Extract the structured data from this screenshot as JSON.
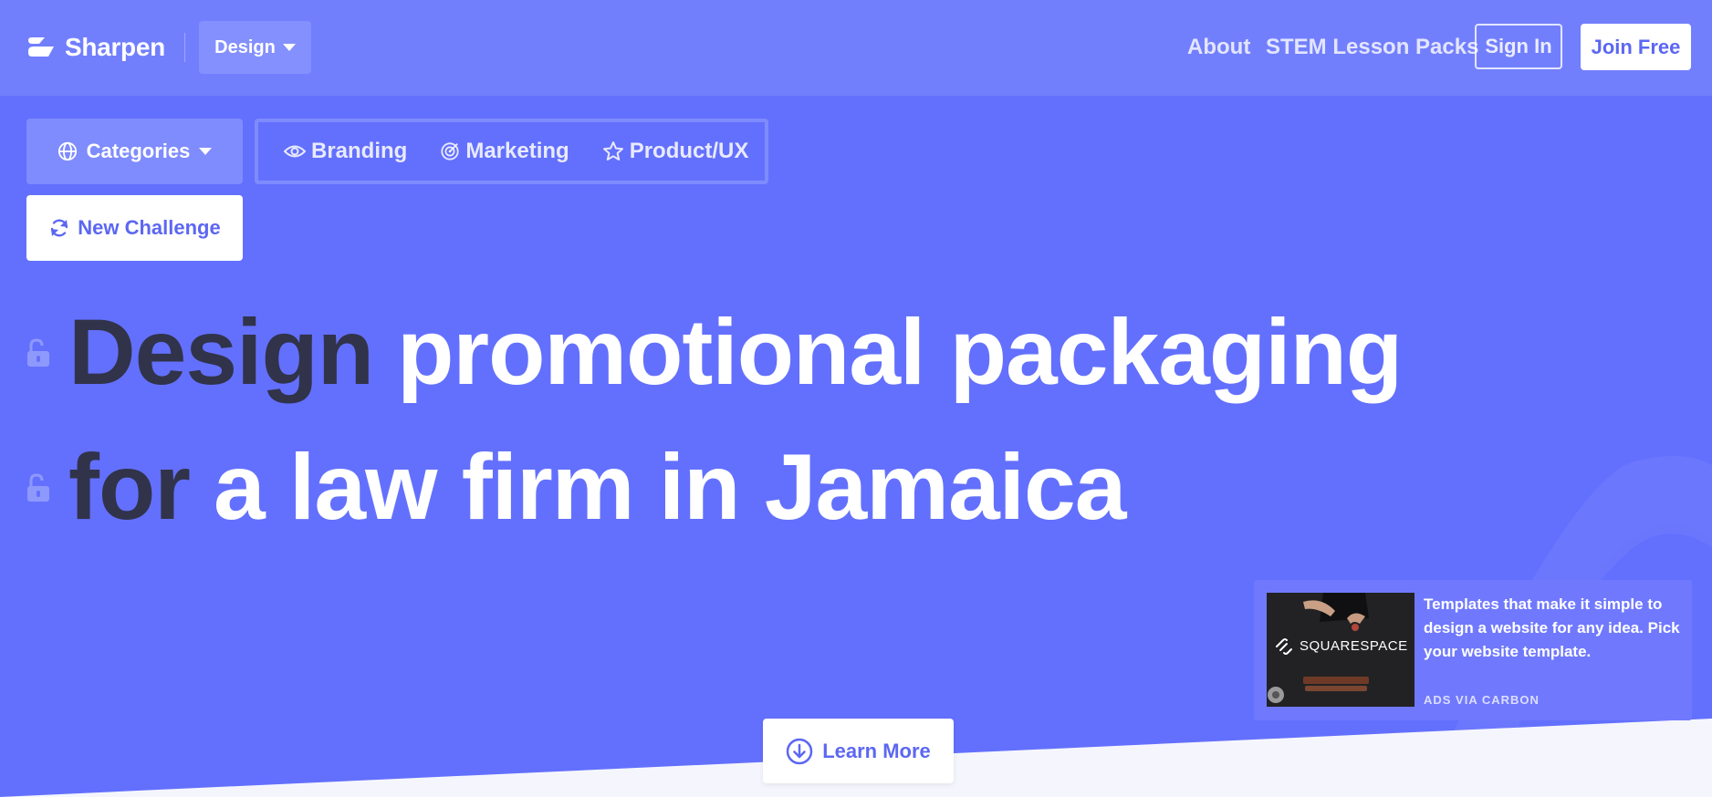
{
  "brand": {
    "name": "Sharpen",
    "accent": "#6370fd",
    "dark_text": "#31334a"
  },
  "header": {
    "category_dropdown": "Design",
    "nav": {
      "about": "About",
      "stem": "STEM Lesson Packs"
    },
    "sign_in": "Sign In",
    "join_free": "Join Free"
  },
  "filters": {
    "categories_label": "Categories",
    "items": [
      {
        "label": "Branding",
        "icon": "eye-icon"
      },
      {
        "label": "Marketing",
        "icon": "target-icon"
      },
      {
        "label": "Product/UX",
        "icon": "star-icon"
      }
    ],
    "new_challenge": "New Challenge"
  },
  "challenge": {
    "line1": {
      "verb": "Design",
      "rest": "promotional packaging"
    },
    "line2": {
      "prefix": "for",
      "rest": "a law firm in Jamaica"
    }
  },
  "ad": {
    "image_brand": "SQUARESPACE",
    "text": "Templates that make it simple to design a website for any idea. Pick your website template.",
    "via": "ADS VIA CARBON"
  },
  "learn_more": "Learn More"
}
